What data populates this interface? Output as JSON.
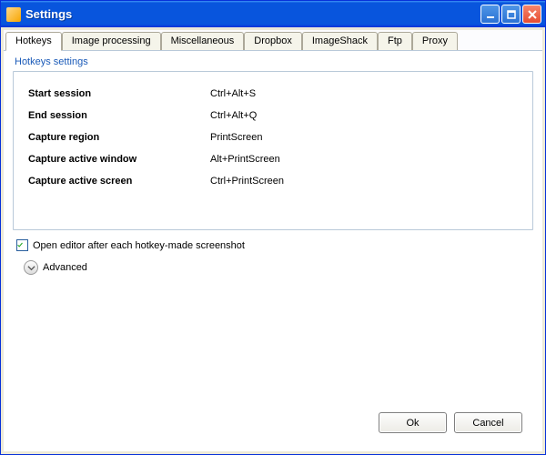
{
  "window": {
    "title": "Settings"
  },
  "tabs": [
    {
      "label": "Hotkeys",
      "active": true
    },
    {
      "label": "Image processing",
      "active": false
    },
    {
      "label": "Miscellaneous",
      "active": false
    },
    {
      "label": "Dropbox",
      "active": false
    },
    {
      "label": "ImageShack",
      "active": false
    },
    {
      "label": "Ftp",
      "active": false
    },
    {
      "label": "Proxy",
      "active": false
    }
  ],
  "groupLabel": "Hotkeys settings",
  "hotkeys": [
    {
      "label": "Start session",
      "value": "Ctrl+Alt+S"
    },
    {
      "label": "End session",
      "value": "Ctrl+Alt+Q"
    },
    {
      "label": "Capture region",
      "value": "PrintScreen"
    },
    {
      "label": "Capture active window",
      "value": "Alt+PrintScreen"
    },
    {
      "label": "Capture active screen",
      "value": "Ctrl+PrintScreen"
    }
  ],
  "openEditor": {
    "checked": true,
    "label": "Open editor after each hotkey-made screenshot"
  },
  "advanced": {
    "label": "Advanced"
  },
  "buttons": {
    "ok": "Ok",
    "cancel": "Cancel"
  }
}
